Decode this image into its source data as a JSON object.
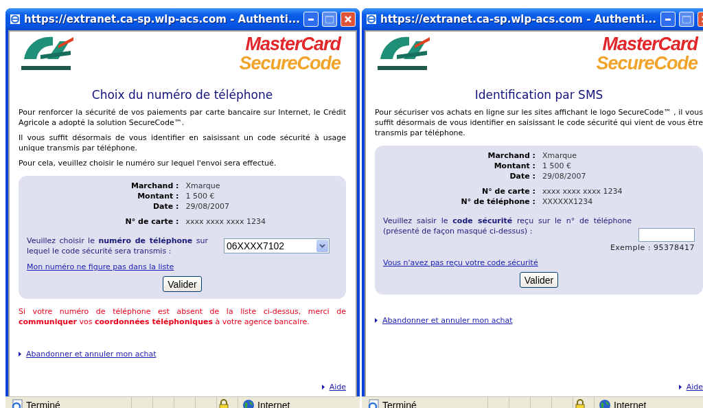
{
  "windows": [
    {
      "title": "https://extranet.ca-sp.wlp-acs.com - Authenti...",
      "brand_logo": [
        "MasterCard",
        "SecureCode"
      ],
      "heading": "Choix du numéro de téléphone",
      "paragraphs": [
        "Pour renforcer la sécurité de vos paiements par carte bancaire sur Internet, le Crédit Agricole a adopté la solution SecureCode™.",
        "Il vous suffit désormais de vous identifier en saisissant un code sécurité à usage unique transmis par téléphone.",
        "Pour cela, veuillez choisir le numéro sur lequel l'envoi sera effectué."
      ],
      "details": [
        [
          {
            "label": "Marchand :",
            "value": "Xmarque"
          },
          {
            "label": "Montant :",
            "value": "1 500 €"
          },
          {
            "label": "Date :",
            "value": "29/08/2007"
          }
        ],
        [
          {
            "label": "N° de carte :",
            "value": "xxxx xxxx xxxx 1234"
          }
        ]
      ],
      "prompt": "Veuillez choisir le **numéro de téléphone** sur lequel le code sécurité sera transmis :",
      "control": {
        "kind": "select",
        "value": "06XXXX7102"
      },
      "link": "Mon numéro ne figure pas dans la liste",
      "button": "Valider",
      "warning": "Si votre numéro de téléphone est absent de la liste ci-dessus, merci de **communiquer** vos **coordonnées téléphoniques** à votre agence bancaire.",
      "cancel_link": "Abandonner et annuler mon achat",
      "help_link": "Aide",
      "status": "Terminé",
      "zone": "Internet"
    },
    {
      "title": "https://extranet.ca-sp.wlp-acs.com - Authenti...",
      "brand_logo": [
        "MasterCard",
        "SecureCode"
      ],
      "heading": "Identification par SMS",
      "paragraphs": [
        "Pour sécuriser vos achats en ligne sur les sites affichant le logo SecureCode™ , il vous suffit désormais de vous identifier en saisissant le code sécurité qui vient de vous être transmis par téléphone."
      ],
      "details": [
        [
          {
            "label": "Marchand :",
            "value": "Xmarque"
          },
          {
            "label": "Montant :",
            "value": "1 500 €"
          },
          {
            "label": "Date :",
            "value": "29/08/2007"
          }
        ],
        [
          {
            "label": "N° de carte :",
            "value": "xxxx xxxx xxxx 1234"
          },
          {
            "label": "N° de téléphone :",
            "value": "XXXXXX1234"
          }
        ]
      ],
      "prompt": "Veuillez saisir le **code sécurité** reçu sur le n° de téléphone (présenté de façon masqué ci-dessus) :",
      "control": {
        "kind": "input",
        "example": "Exemple : 95378417"
      },
      "link": "Vous n'avez pas reçu votre code sécurité",
      "button": "Valider",
      "cancel_link": "Abandonner et annuler mon achat",
      "help_link": "Aide",
      "status": "Terminé",
      "zone": "Internet"
    }
  ]
}
